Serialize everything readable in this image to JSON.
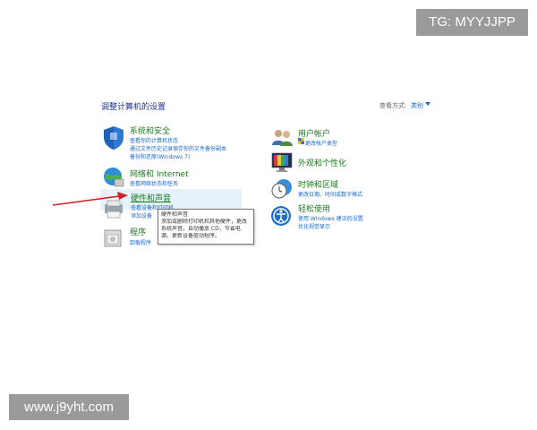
{
  "watermarks": {
    "top": "TG: MYYJJPP",
    "bottom": "www.j9yht.com"
  },
  "header": {
    "title": "调整计算机的设置",
    "view_by_label": "查看方式:",
    "view_by_value": "类别"
  },
  "categories": {
    "system_security": {
      "title": "系统和安全",
      "links": [
        "查看你的计算机状态",
        "通过文件历史记录保存你的文件备份副本",
        "备份和还原(Windows 7)"
      ],
      "icon": "shield-icon"
    },
    "network": {
      "title": "网络和 Internet",
      "links": [
        "查看网络状态和任务"
      ],
      "icon": "globe-network-icon"
    },
    "hardware_sound": {
      "title": "硬件和声音",
      "links": [
        "查看设备和打印机",
        "添加设备"
      ],
      "icon": "printer-speaker-icon"
    },
    "programs": {
      "title": "程序",
      "links": [
        "卸载程序"
      ],
      "icon": "programs-icon"
    },
    "user_accounts": {
      "title": "用户帐户",
      "links": [
        "更改帐户类型"
      ],
      "icon": "users-icon"
    },
    "appearance": {
      "title": "外观和个性化",
      "links": [],
      "icon": "monitor-personalize-icon"
    },
    "clock_region": {
      "title": "时钟和区域",
      "links": [
        "更改日期、时间或数字格式"
      ],
      "icon": "clock-globe-icon"
    },
    "ease_of_access": {
      "title": "轻松使用",
      "links": [
        "使用 Windows 建议的设置",
        "优化视觉显示"
      ],
      "icon": "accessibility-icon"
    }
  },
  "tooltip": {
    "lines": [
      "硬件和声音",
      "添加或删除打印机和其他硬件，更改",
      "系统声音，自动播放 CD，节省电",
      "源，更新设备驱动程序。"
    ]
  },
  "colors": {
    "title_green": "#1e7a1e",
    "link_blue": "#1a67c8",
    "arrow_red": "#d42020",
    "hover_bg": "#e5f1fb"
  }
}
